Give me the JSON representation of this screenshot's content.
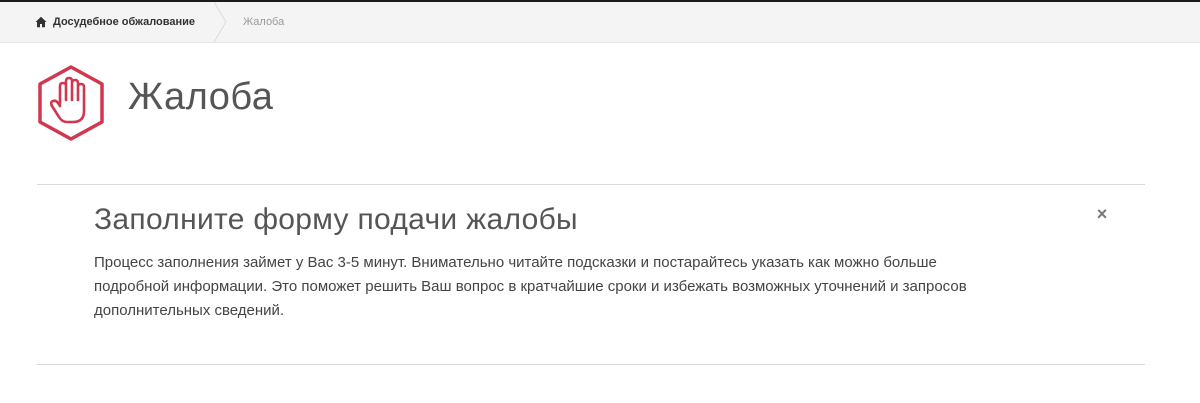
{
  "breadcrumb": {
    "home_label": "Досудебное обжалование",
    "current_label": "Жалоба",
    "home_icon": "home-icon"
  },
  "header": {
    "title": "Жалоба",
    "logo_icon": "hand-stop-icon",
    "accent_color": "#d1374f"
  },
  "alert": {
    "heading": "Заполните форму подачи жалобы",
    "text_lines": [
      "Процесс заполнения займет у Вас 3-5 минут. Внимательно читайте подсказки и постарайтесь указать как можно больше",
      "подробной информации. Это поможет решить Ваш вопрос в кратчайшие сроки и избежать возможных уточнений и запросов",
      "дополнительных сведений."
    ],
    "close_label": "×",
    "close_icon": "close-icon"
  }
}
